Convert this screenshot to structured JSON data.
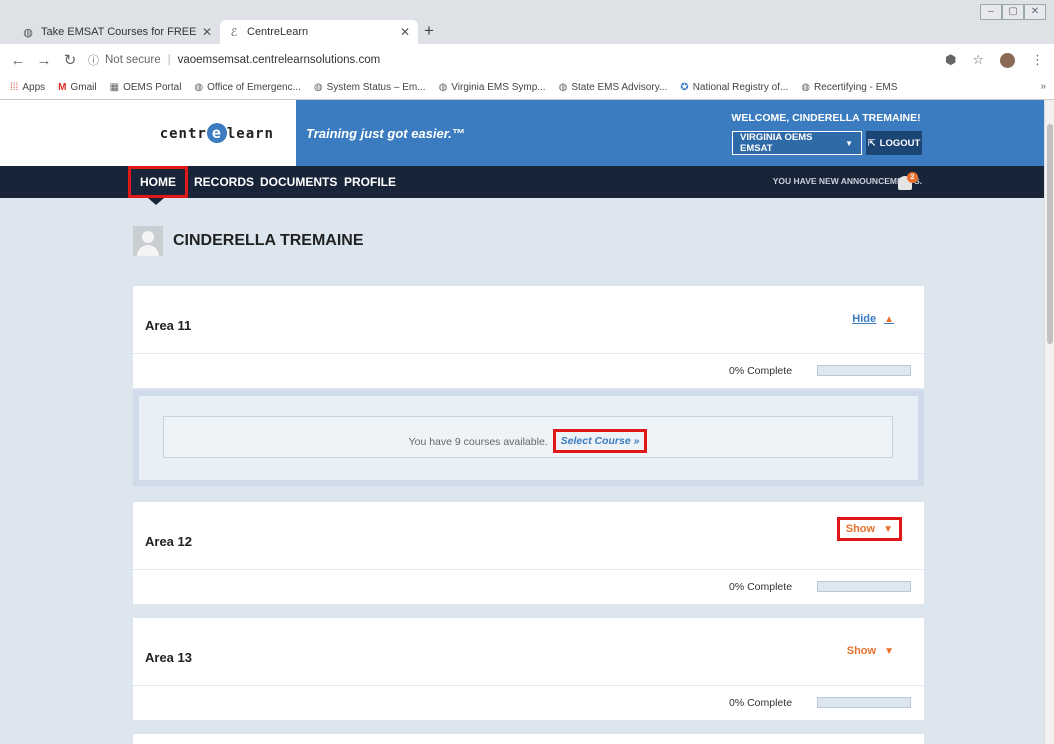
{
  "browser": {
    "tabs": [
      {
        "title": "Take EMSAT Courses for FREE or",
        "active": false
      },
      {
        "title": "CentreLearn",
        "active": true
      }
    ],
    "url_prefix": "Not secure",
    "url": "vaoemsemsat.centrelearnsolutions.com",
    "bookmarks": [
      {
        "label": "Apps",
        "icon": "apps-grid-icon"
      },
      {
        "label": "Gmail",
        "icon": "gmail-icon"
      },
      {
        "label": "OEMS Portal",
        "icon": "page-icon"
      },
      {
        "label": "Office of Emergenc...",
        "icon": "globe-icon"
      },
      {
        "label": "System Status – Em...",
        "icon": "globe-icon"
      },
      {
        "label": "Virginia EMS Symp...",
        "icon": "globe-icon"
      },
      {
        "label": "State EMS Advisory...",
        "icon": "globe-icon"
      },
      {
        "label": "National Registry of...",
        "icon": "registry-icon"
      },
      {
        "label": "Recertifying - EMS",
        "icon": "globe-icon"
      }
    ]
  },
  "header": {
    "logo": "centrelearn",
    "tagline": "Training just got easier.™",
    "welcome": "WELCOME, CINDERELLA TREMAINE!",
    "org_select": "VIRGINIA OEMS EMSAT",
    "logout": "LOGOUT"
  },
  "nav": {
    "items": [
      "HOME",
      "RECORDS",
      "DOCUMENTS",
      "PROFILE"
    ],
    "announcement": "YOU HAVE NEW ANNOUNCEMENTS.",
    "badge_count": "2"
  },
  "user": {
    "name": "CINDERELLA TREMAINE"
  },
  "areas": [
    {
      "title": "Area 11",
      "toggle": "Hide",
      "progress_label": "0% Complete",
      "progress": 0
    },
    {
      "title": "Area 12",
      "toggle": "Show",
      "progress_label": "0% Complete",
      "progress": 0
    },
    {
      "title": "Area 13",
      "toggle": "Show",
      "progress_label": "0% Complete",
      "progress": 0
    }
  ],
  "courses": {
    "text": "You have 9 courses available.",
    "link": "Select Course »"
  },
  "colors": {
    "brand_blue": "#3b7bbf",
    "nav_dark": "#182538",
    "accent_orange": "#e8722d",
    "highlight_red": "#e01818"
  }
}
